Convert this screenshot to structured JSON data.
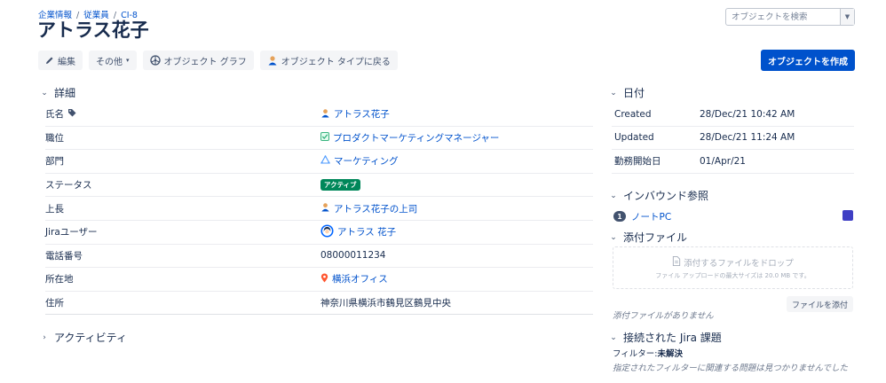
{
  "breadcrumb": {
    "items": [
      "企業情報",
      "従業員",
      "CI-8"
    ],
    "separator": "/"
  },
  "page_title": "アトラス花子",
  "search": {
    "placeholder": "オブジェクトを検索"
  },
  "toolbar": {
    "edit_label": "編集",
    "more_label": "その他",
    "graph_label": "オブジェクト グラフ",
    "back_label": "オブジェクト タイプに戻る"
  },
  "create_button_label": "オブジェクトを作成",
  "details": {
    "heading": "詳細",
    "rows": [
      {
        "label": "氏名",
        "value": "アトラス花子"
      },
      {
        "label": "職位",
        "value": "プロダクトマーケティングマネージャー"
      },
      {
        "label": "部門",
        "value": "マーケティング"
      },
      {
        "label": "ステータス",
        "value": "アクティブ"
      },
      {
        "label": "上長",
        "value": "アトラス花子の上司"
      },
      {
        "label": "Jiraユーザー",
        "value": "アトラス 花子"
      },
      {
        "label": "電話番号",
        "value": "08000011234"
      },
      {
        "label": "所在地",
        "value": "横浜オフィス"
      },
      {
        "label": "住所",
        "value": "神奈川県横浜市鶴見区鶴見中央"
      }
    ]
  },
  "activity": {
    "heading": "アクティビティ"
  },
  "dates": {
    "heading": "日付",
    "rows": [
      {
        "label": "Created",
        "value": "28/Dec/21 10:42 AM"
      },
      {
        "label": "Updated",
        "value": "28/Dec/21 11:24 AM"
      },
      {
        "label": "勤務開始日",
        "value": "01/Apr/21"
      }
    ]
  },
  "inbound": {
    "heading": "インバウンド参照",
    "items": [
      {
        "count": "1",
        "label": "ノートPC",
        "color": "#3f3fc4"
      }
    ]
  },
  "attachments": {
    "heading": "添付ファイル",
    "drop_text": "添付するファイルをドロップ",
    "max_size_text": "ファイル アップロードの最大サイズは 20.0 MB です。",
    "attach_button": "ファイルを添付",
    "empty_text": "添付ファイルがありません"
  },
  "jira_issues": {
    "heading": "接続された Jira 課題",
    "filter_label": "フィルター:",
    "filter_value": "未解決",
    "empty_text": "指定されたフィルターに関連する問題は見つかりませんでした"
  },
  "colors": {
    "primary": "#0052cc",
    "status_active": "#00875a",
    "text": "#172b4d"
  }
}
